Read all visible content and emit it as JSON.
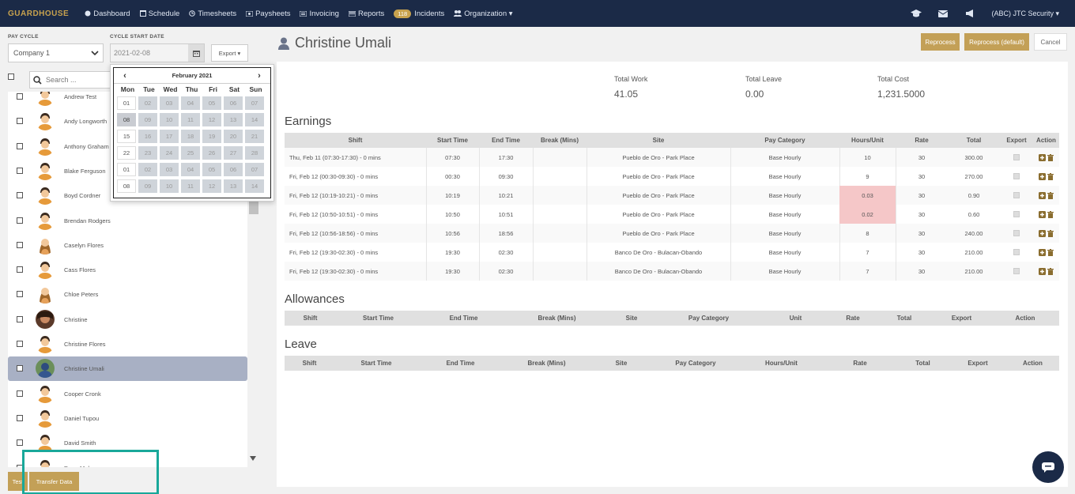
{
  "nav": {
    "logo": "GUARDHOUSE",
    "items": [
      {
        "label": "Dashboard",
        "icon": "dashboard-icon"
      },
      {
        "label": "Schedule",
        "icon": "calendar-icon"
      },
      {
        "label": "Timesheets",
        "icon": "clock-icon"
      },
      {
        "label": "Paysheets",
        "icon": "money-icon"
      },
      {
        "label": "Invoicing",
        "icon": "invoice-icon"
      },
      {
        "label": "Reports",
        "icon": "report-icon"
      },
      {
        "label": "Incidents",
        "icon": "incident-icon",
        "badge": "118"
      },
      {
        "label": "Organization ▾",
        "icon": "users-icon"
      }
    ],
    "company": "(ABC) JTC Security ▾"
  },
  "filters": {
    "pay_cycle_label": "PAY CYCLE",
    "pay_cycle_value": "Company 1",
    "cycle_start_label": "CYCLE START DATE",
    "cycle_start_value": "2021-02-08",
    "export_label": "Export ▾",
    "search_placeholder": "Search ..."
  },
  "calendar": {
    "month": "February 2021",
    "dow": [
      "Mon",
      "Tue",
      "Wed",
      "Thu",
      "Fri",
      "Sat",
      "Sun"
    ],
    "weeks": [
      [
        "01",
        "02",
        "03",
        "04",
        "05",
        "06",
        "07"
      ],
      [
        "08",
        "09",
        "10",
        "11",
        "12",
        "13",
        "14"
      ],
      [
        "15",
        "16",
        "17",
        "18",
        "19",
        "20",
        "21"
      ],
      [
        "22",
        "23",
        "24",
        "25",
        "26",
        "27",
        "28"
      ],
      [
        "01",
        "02",
        "03",
        "04",
        "05",
        "06",
        "07"
      ],
      [
        "08",
        "09",
        "10",
        "11",
        "12",
        "13",
        "14"
      ]
    ]
  },
  "employees": [
    {
      "name": "Andrew Test",
      "avatar": "default"
    },
    {
      "name": "Andy Longworth",
      "avatar": "default"
    },
    {
      "name": "Anthony Graham",
      "avatar": "default"
    },
    {
      "name": "Blake Ferguson",
      "avatar": "default"
    },
    {
      "name": "Boyd Cordner",
      "avatar": "default"
    },
    {
      "name": "Brendan Rodgers",
      "avatar": "default"
    },
    {
      "name": "Caselyn Flores",
      "avatar": "female"
    },
    {
      "name": "Cass Flores",
      "avatar": "default"
    },
    {
      "name": "Chloe Peters",
      "avatar": "female"
    },
    {
      "name": "Christine",
      "avatar": "photo"
    },
    {
      "name": "Christine Flores",
      "avatar": "default"
    },
    {
      "name": "Christine Umali",
      "avatar": "photo2",
      "selected": true
    },
    {
      "name": "Cooper Cronk",
      "avatar": "default"
    },
    {
      "name": "Daniel Tupou",
      "avatar": "default"
    },
    {
      "name": "David Smith",
      "avatar": "default"
    },
    {
      "name": "Dean Mal...",
      "avatar": "default"
    }
  ],
  "bottom_buttons": {
    "test": "Test",
    "transfer": "Transfer Data"
  },
  "employee": {
    "name": "Christine Umali"
  },
  "actions": {
    "reprocess": "Reprocess",
    "reprocess_default": "Reprocess (default)",
    "cancel": "Cancel"
  },
  "totals": [
    {
      "label": "Total Work",
      "value": "41.05"
    },
    {
      "label": "Total Leave",
      "value": "0.00"
    },
    {
      "label": "Total Cost",
      "value": "1,231.5000"
    }
  ],
  "earnings": {
    "title": "Earnings",
    "headers": [
      "Shift",
      "Start Time",
      "End Time",
      "Break (Mins)",
      "Site",
      "Pay Category",
      "Hours/Unit",
      "Rate",
      "Total",
      "Export",
      "Action"
    ],
    "rows": [
      {
        "shift": "Thu, Feb 11 (07:30-17:30) - 0 mins",
        "start": "07:30",
        "end": "17:30",
        "break": "",
        "site": "Pueblo de Oro - Park Place",
        "cat": "Base Hourly",
        "hours": "10",
        "rate": "30",
        "total": "300.00",
        "flag": false
      },
      {
        "shift": "Fri, Feb 12 (00:30-09:30) - 0 mins",
        "start": "00:30",
        "end": "09:30",
        "break": "",
        "site": "Pueblo de Oro - Park Place",
        "cat": "Base Hourly",
        "hours": "9",
        "rate": "30",
        "total": "270.00",
        "flag": false
      },
      {
        "shift": "Fri, Feb 12 (10:19-10:21) - 0 mins",
        "start": "10:19",
        "end": "10:21",
        "break": "",
        "site": "Pueblo de Oro - Park Place",
        "cat": "Base Hourly",
        "hours": "0.03",
        "rate": "30",
        "total": "0.90",
        "flag": true
      },
      {
        "shift": "Fri, Feb 12 (10:50-10:51) - 0 mins",
        "start": "10:50",
        "end": "10:51",
        "break": "",
        "site": "Pueblo de Oro - Park Place",
        "cat": "Base Hourly",
        "hours": "0.02",
        "rate": "30",
        "total": "0.60",
        "flag": true
      },
      {
        "shift": "Fri, Feb 12 (10:56-18:56) - 0 mins",
        "start": "10:56",
        "end": "18:56",
        "break": "",
        "site": "Pueblo de Oro - Park Place",
        "cat": "Base Hourly",
        "hours": "8",
        "rate": "30",
        "total": "240.00",
        "flag": false
      },
      {
        "shift": "Fri, Feb 12 (19:30-02:30) - 0 mins",
        "start": "19:30",
        "end": "02:30",
        "break": "",
        "site": "Banco De Oro - Bulacan-Obando",
        "cat": "Base Hourly",
        "hours": "7",
        "rate": "30",
        "total": "210.00",
        "flag": false
      },
      {
        "shift": "Fri, Feb 12 (19:30-02:30) - 0 mins",
        "start": "19:30",
        "end": "02:30",
        "break": "",
        "site": "Banco De Oro - Bulacan-Obando",
        "cat": "Base Hourly",
        "hours": "7",
        "rate": "30",
        "total": "210.00",
        "flag": false
      }
    ]
  },
  "allowances": {
    "title": "Allowances",
    "headers": [
      "Shift",
      "Start Time",
      "End Time",
      "Break (Mins)",
      "Site",
      "Pay Category",
      "Unit",
      "Rate",
      "Total",
      "Export",
      "Action"
    ]
  },
  "leave": {
    "title": "Leave",
    "headers": [
      "Shift",
      "Start Time",
      "End Time",
      "Break (Mins)",
      "Site",
      "Pay Category",
      "Hours/Unit",
      "Rate",
      "Total",
      "Export",
      "Action"
    ]
  },
  "colors": {
    "navy": "#1b2a47",
    "gold": "#c3a057",
    "highlight": "#19a89a",
    "flag": "#f5c7c8"
  }
}
